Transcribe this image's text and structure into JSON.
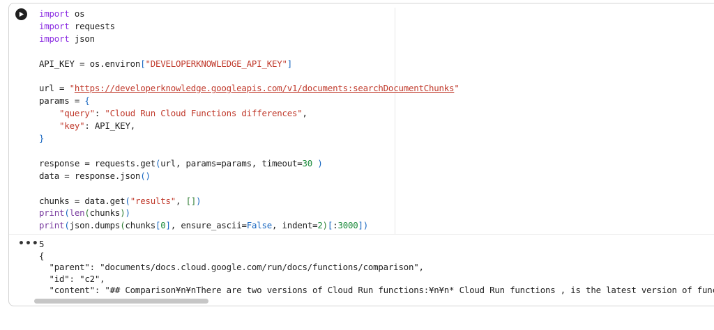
{
  "cell": {
    "run_button_icon": "play-icon",
    "code_lines": [
      {
        "segments": [
          {
            "t": "import",
            "c": "kw"
          },
          {
            "t": " os",
            "c": ""
          }
        ]
      },
      {
        "segments": [
          {
            "t": "import",
            "c": "kw"
          },
          {
            "t": " requests",
            "c": ""
          }
        ]
      },
      {
        "segments": [
          {
            "t": "import",
            "c": "kw"
          },
          {
            "t": " json",
            "c": ""
          }
        ]
      },
      {
        "segments": []
      },
      {
        "segments": [
          {
            "t": "API_KEY = os.environ",
            "c": ""
          },
          {
            "t": "[",
            "c": "br"
          },
          {
            "t": "\"DEVELOPERKNOWLEDGE_API_KEY\"",
            "c": "str"
          },
          {
            "t": "]",
            "c": "br"
          }
        ]
      },
      {
        "segments": []
      },
      {
        "segments": [
          {
            "t": "url = ",
            "c": ""
          },
          {
            "t": "\"",
            "c": "str"
          },
          {
            "t": "https://developerknowledge.googleapis.com/v1/documents:searchDocumentChunks",
            "c": "url"
          },
          {
            "t": "\"",
            "c": "str"
          }
        ]
      },
      {
        "segments": [
          {
            "t": "params = ",
            "c": ""
          },
          {
            "t": "{",
            "c": "br"
          }
        ]
      },
      {
        "segments": [
          {
            "t": "    ",
            "c": ""
          },
          {
            "t": "\"query\"",
            "c": "str"
          },
          {
            "t": ": ",
            "c": ""
          },
          {
            "t": "\"Cloud Run Cloud Functions differences\"",
            "c": "str"
          },
          {
            "t": ",",
            "c": ""
          }
        ]
      },
      {
        "segments": [
          {
            "t": "    ",
            "c": ""
          },
          {
            "t": "\"key\"",
            "c": "str"
          },
          {
            "t": ": API_KEY,",
            "c": ""
          }
        ]
      },
      {
        "segments": [
          {
            "t": "}",
            "c": "br"
          }
        ]
      },
      {
        "segments": []
      },
      {
        "segments": [
          {
            "t": "response = requests.get",
            "c": ""
          },
          {
            "t": "(",
            "c": "br"
          },
          {
            "t": "url, params=params, timeout=",
            "c": ""
          },
          {
            "t": "30",
            "c": "num"
          },
          {
            "t": " )",
            "c": "br"
          }
        ]
      },
      {
        "segments": [
          {
            "t": "data = response.json",
            "c": ""
          },
          {
            "t": "()",
            "c": "br"
          }
        ]
      },
      {
        "segments": []
      },
      {
        "segments": [
          {
            "t": "chunks = data.get",
            "c": ""
          },
          {
            "t": "(",
            "c": "br"
          },
          {
            "t": "\"results\"",
            "c": "str"
          },
          {
            "t": ", ",
            "c": ""
          },
          {
            "t": "[]",
            "c": "brg"
          },
          {
            "t": ")",
            "c": "br"
          }
        ]
      },
      {
        "segments": [
          {
            "t": "print",
            "c": "fn"
          },
          {
            "t": "(",
            "c": "br"
          },
          {
            "t": "len",
            "c": "fn"
          },
          {
            "t": "(",
            "c": "brg"
          },
          {
            "t": "chunks",
            "c": ""
          },
          {
            "t": ")",
            "c": "brg"
          },
          {
            "t": ")",
            "c": "br"
          }
        ]
      },
      {
        "segments": [
          {
            "t": "print",
            "c": "fn"
          },
          {
            "t": "(",
            "c": "br"
          },
          {
            "t": "json.dumps",
            "c": ""
          },
          {
            "t": "(",
            "c": "brg"
          },
          {
            "t": "chunks",
            "c": ""
          },
          {
            "t": "[",
            "c": "br"
          },
          {
            "t": "0",
            "c": "num"
          },
          {
            "t": "]",
            "c": "br"
          },
          {
            "t": ", ensure_ascii=",
            "c": ""
          },
          {
            "t": "False",
            "c": "lit"
          },
          {
            "t": ", indent=",
            "c": ""
          },
          {
            "t": "2",
            "c": "num"
          },
          {
            "t": ")",
            "c": "brg"
          },
          {
            "t": "[",
            "c": "br"
          },
          {
            "t": ":",
            "c": ""
          },
          {
            "t": "3000",
            "c": "num"
          },
          {
            "t": "]",
            "c": "br"
          },
          {
            "t": ")",
            "c": "br"
          }
        ]
      }
    ]
  },
  "output": {
    "menu_label": "•••",
    "lines": [
      "5",
      "{",
      "  \"parent\": \"documents/docs.cloud.google.com/run/docs/functions/comparison\",",
      "  \"id\": \"c2\",",
      "  \"content\": \"## Comparison¥n¥nThere are two versions of Cloud Run functions:¥n¥n* Cloud Run functions , is the latest version of functions,¥n[deployed"
    ]
  }
}
